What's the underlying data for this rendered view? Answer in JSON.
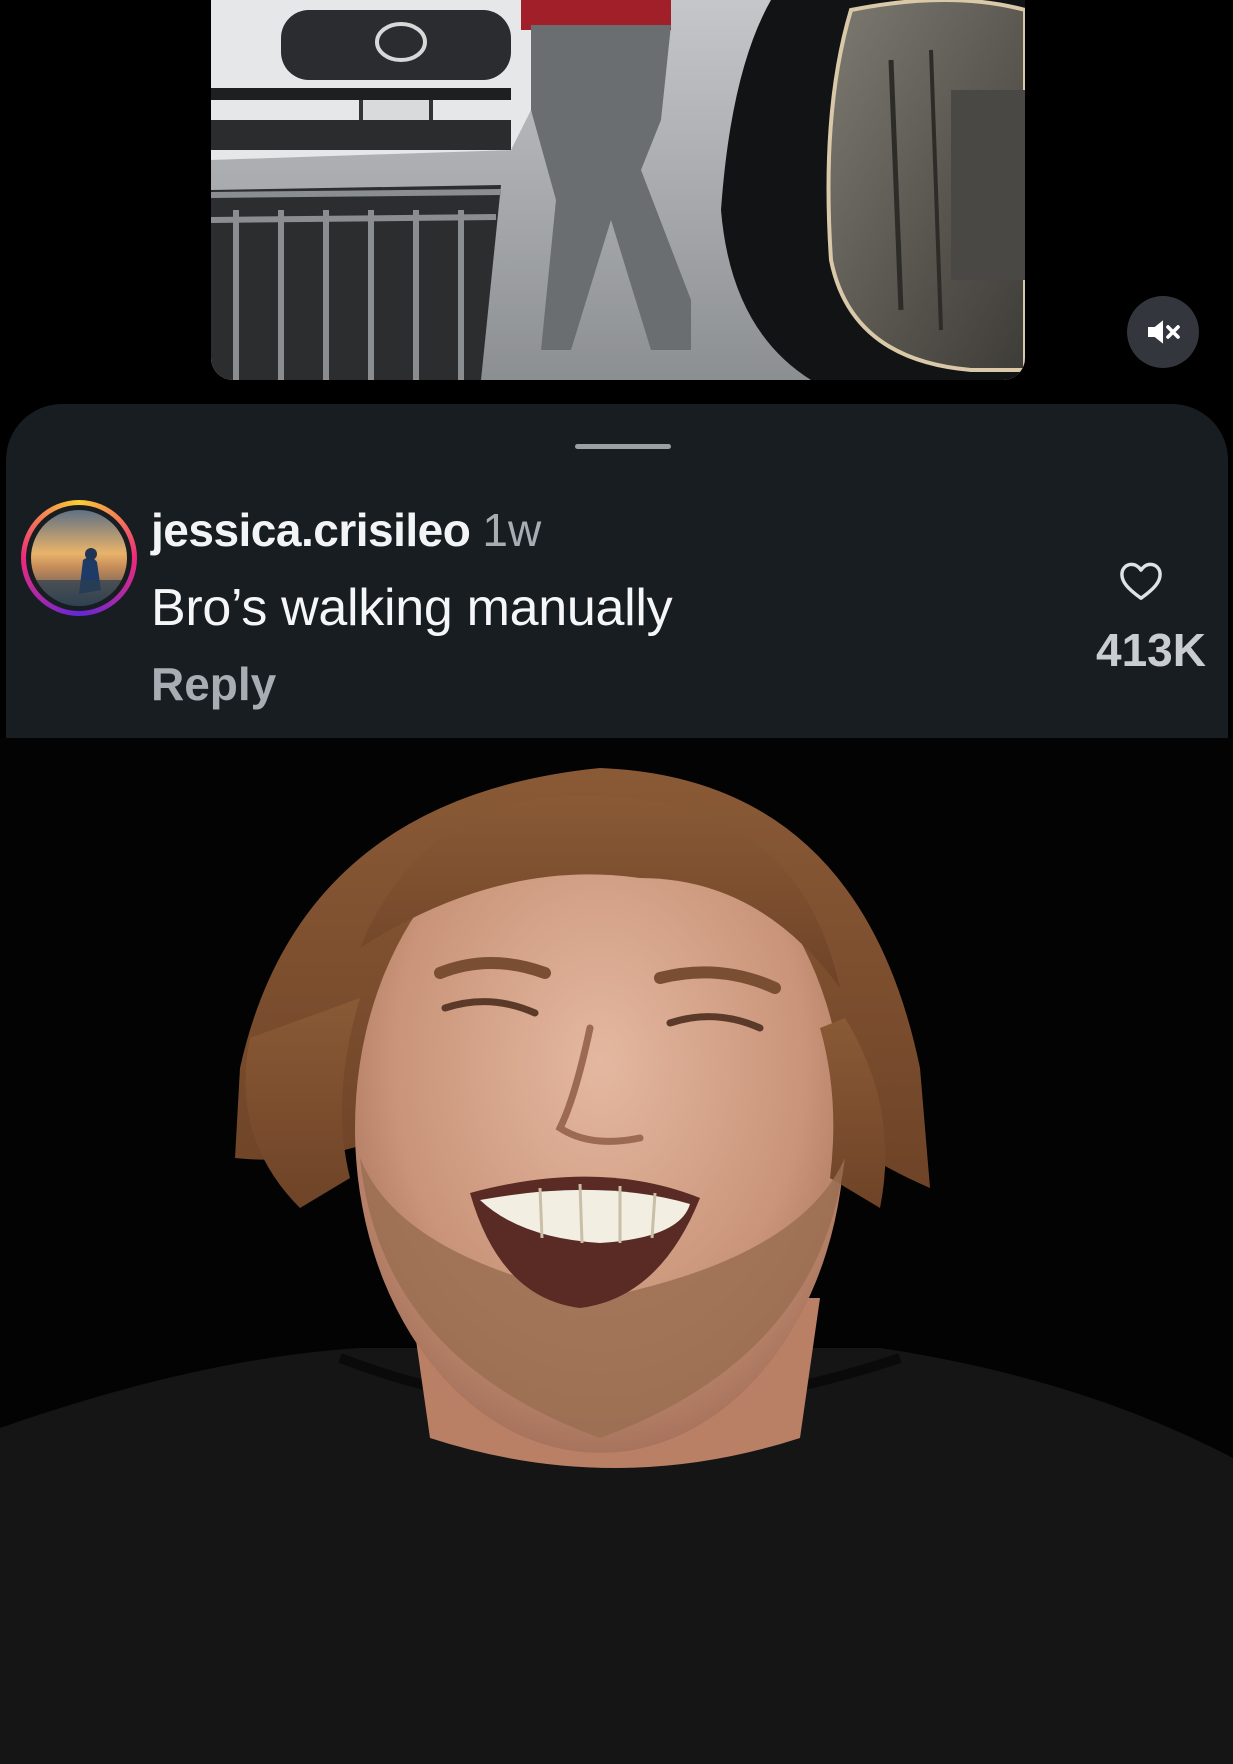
{
  "video_player": {
    "mute_icon": "speaker-muted-icon"
  },
  "comment": {
    "username": "jessica.crisileo",
    "time_ago": "1w",
    "text": "Bro’s walking manually",
    "reply_label": "Reply",
    "like_icon": "heart-outline-icon",
    "like_count": "413K"
  },
  "colors": {
    "sheet_background": "#181d22",
    "page_background": "#000000",
    "avatar_ring": [
      "#f9ce34",
      "#ee2a7b",
      "#6228d7"
    ],
    "muted_text": "#a8adb3"
  }
}
